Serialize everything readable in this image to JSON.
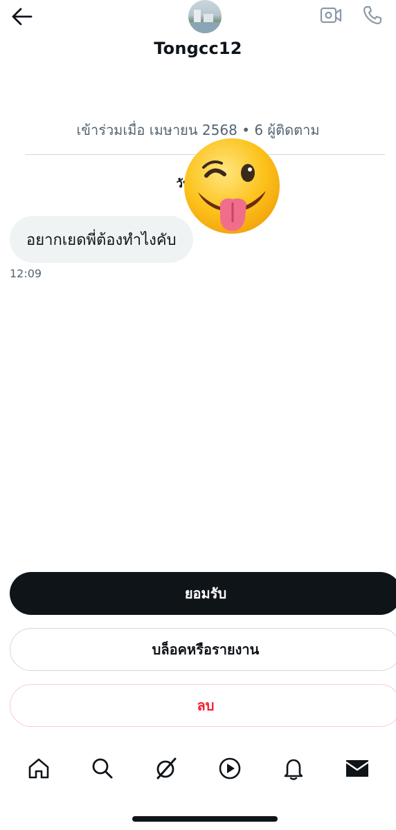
{
  "header": {
    "back_icon": "arrow-left-icon",
    "username": "Tongcc12",
    "video_icon": "video-camera-icon",
    "phone_icon": "phone-icon"
  },
  "profile": {
    "joined_text": "เข้าร่วมเมื่อ เมษายน 2568 • 6 ผู้ติดตาม"
  },
  "conversation": {
    "day_label": "วันจันทร์",
    "messages": [
      {
        "text": "อยากเยดพี่ต้องทำไงคับ",
        "time": "12:09"
      }
    ]
  },
  "actions": {
    "accept": "ยอมรับ",
    "block_or_report": "บล็อคหรือรายงาน",
    "delete": "ลบ"
  },
  "nav": {
    "items": [
      "home-icon",
      "search-icon",
      "grok-icon",
      "video-play-icon",
      "bell-icon",
      "mail-icon"
    ],
    "active": "mail-icon"
  },
  "colors": {
    "primary_text": "#0f1419",
    "secondary_text": "#536471",
    "danger": "#f4212e",
    "bubble": "#eff3f4"
  }
}
